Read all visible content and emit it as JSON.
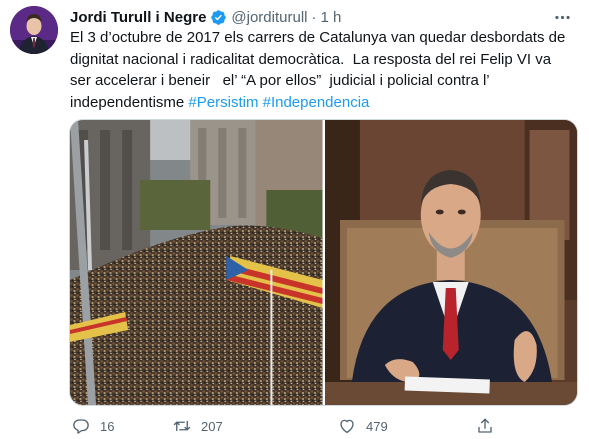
{
  "tweet": {
    "author_name": "Jordi Turull i Negre",
    "handle": "@jorditurull",
    "separator": "·",
    "time": "1 h",
    "text_main": "El 3 d’octubre de 2017 els carrers de Catalunya van quedar desbordats de dignitat nacional i radicalitat democràtica.  La resposta del rei Felip VI va ser accelerar i beneir   el’ “A por ellos”  judicial i policial contra l’ independentisme ",
    "hashtags": [
      "#Persistim",
      "#Independencia"
    ]
  },
  "actions": {
    "replies": "16",
    "retweets": "207",
    "likes": "479"
  },
  "colors": {
    "link": "#1d9bf0",
    "verified": "#1d9bf0",
    "secondary_text": "#536471"
  },
  "icons": {
    "verified": "verified-badge-icon",
    "more": "more-options-icon",
    "reply": "reply-icon",
    "retweet": "retweet-icon",
    "like": "heart-icon",
    "share": "share-icon"
  }
}
